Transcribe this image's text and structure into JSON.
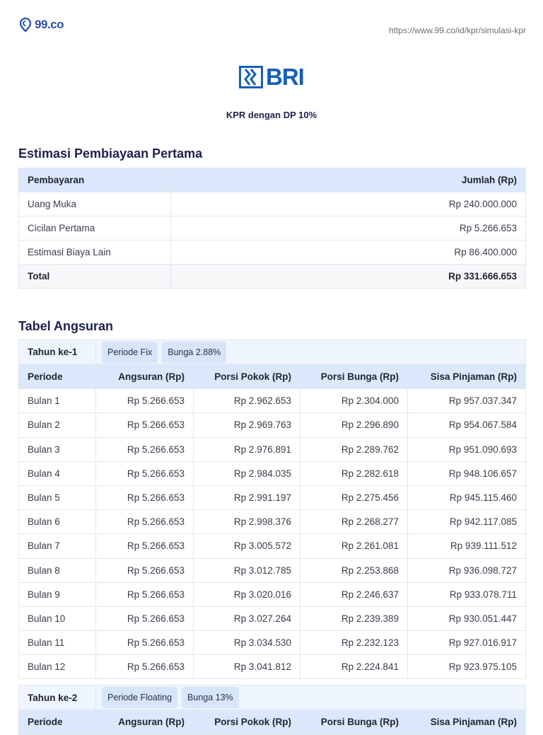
{
  "header": {
    "brand": "99.co",
    "url": "https://www.99.co/id/kpr/simulasi-kpr"
  },
  "bank": {
    "name": "BRI",
    "subtitle": "KPR dengan DP 10%"
  },
  "estimasi": {
    "title": "Estimasi Pembiayaan Pertama",
    "columns": [
      "Pembayaran",
      "Jumlah (Rp)"
    ],
    "rows": [
      {
        "label": "Uang Muka",
        "value": "Rp 240.000.000"
      },
      {
        "label": "Cicilan Pertama",
        "value": "Rp 5.266.653"
      },
      {
        "label": "Estimasi Biaya Lain",
        "value": "Rp 86.400.000"
      }
    ],
    "total": {
      "label": "Total",
      "value": "Rp 331.666.653"
    }
  },
  "angsuran": {
    "title": "Tabel Angsuran",
    "columns": [
      "Periode",
      "Angsuran (Rp)",
      "Porsi Pokok (Rp)",
      "Porsi Bunga (Rp)",
      "Sisa Pinjaman (Rp)"
    ],
    "years": [
      {
        "label": "Tahun ke-1",
        "periode": "Periode Fix",
        "bunga": "Bunga 2.88%",
        "rows": [
          [
            "Bulan 1",
            "Rp 5.266.653",
            "Rp 2.962.653",
            "Rp 2.304.000",
            "Rp 957.037.347"
          ],
          [
            "Bulan 2",
            "Rp 5.266.653",
            "Rp 2.969.763",
            "Rp 2.296.890",
            "Rp 954.067.584"
          ],
          [
            "Bulan 3",
            "Rp 5.266.653",
            "Rp 2.976.891",
            "Rp 2.289.762",
            "Rp 951.090.693"
          ],
          [
            "Bulan 4",
            "Rp 5.266.653",
            "Rp 2.984.035",
            "Rp 2.282.618",
            "Rp 948.106.657"
          ],
          [
            "Bulan 5",
            "Rp 5.266.653",
            "Rp 2.991.197",
            "Rp 2.275.456",
            "Rp 945.115.460"
          ],
          [
            "Bulan 6",
            "Rp 5.266.653",
            "Rp 2.998.376",
            "Rp 2.268.277",
            "Rp 942.117.085"
          ],
          [
            "Bulan 7",
            "Rp 5.266.653",
            "Rp 3.005.572",
            "Rp 2.261.081",
            "Rp 939.111.512"
          ],
          [
            "Bulan 8",
            "Rp 5.266.653",
            "Rp 3.012.785",
            "Rp 2.253.868",
            "Rp 936.098.727"
          ],
          [
            "Bulan 9",
            "Rp 5.266.653",
            "Rp 3.020.016",
            "Rp 2.246.637",
            "Rp 933.078.711"
          ],
          [
            "Bulan 10",
            "Rp 5.266.653",
            "Rp 3.027.264",
            "Rp 2.239.389",
            "Rp 930.051.447"
          ],
          [
            "Bulan 11",
            "Rp 5.266.653",
            "Rp 3.034.530",
            "Rp 2.232.123",
            "Rp 927.016.917"
          ],
          [
            "Bulan 12",
            "Rp 5.266.653",
            "Rp 3.041.812",
            "Rp 2.224.841",
            "Rp 923.975.105"
          ]
        ]
      },
      {
        "label": "Tahun ke-2",
        "periode": "Periode Floating",
        "bunga": "Bunga 13%"
      }
    ]
  }
}
